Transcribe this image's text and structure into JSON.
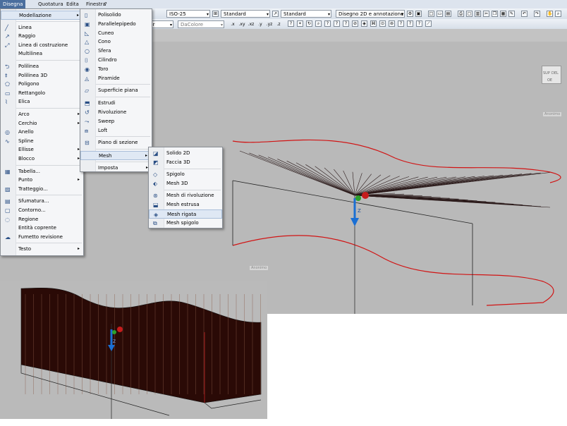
{
  "menubar": {
    "items": [
      {
        "label": "Disegna",
        "active": true
      },
      {
        "label": "Quotatura"
      },
      {
        "label": "Edita"
      },
      {
        "label": "Finestra"
      },
      {
        "label": "?"
      }
    ]
  },
  "toolbar": {
    "dimstyle": "ISO-25",
    "tablestyle": "Standard",
    "mleaderstyle": "Standard",
    "workspace": "Disegno 2D e annotazione",
    "layer_fragment": "yer",
    "color": "DaColore",
    "ucs_buttons": [
      ".x",
      ".xy",
      ".xz",
      ".y",
      ".yz",
      ".z"
    ]
  },
  "main_menu": {
    "items": [
      {
        "label": "Modellazione",
        "submenu": true,
        "highlight": true,
        "icon": "none-icon"
      },
      {
        "sep": true
      },
      {
        "label": "Linea",
        "icon": "line-icon"
      },
      {
        "label": "Raggio",
        "icon": "ray-icon"
      },
      {
        "label": "Linea di costruzione",
        "icon": "xline-icon"
      },
      {
        "label": "Multilinea",
        "icon": "none-icon"
      },
      {
        "sep": true
      },
      {
        "label": "Polilinea",
        "icon": "polyline-icon"
      },
      {
        "label": "Polilinea 3D",
        "icon": "3dpoly-icon"
      },
      {
        "label": "Poligono",
        "icon": "polygon-icon"
      },
      {
        "label": "Rettangolo",
        "icon": "rectangle-icon"
      },
      {
        "label": "Elica",
        "icon": "helix-icon"
      },
      {
        "sep": true
      },
      {
        "label": "Arco",
        "submenu": true,
        "icon": "none-icon"
      },
      {
        "label": "Cerchio",
        "submenu": true,
        "icon": "none-icon"
      },
      {
        "label": "Anello",
        "icon": "donut-icon"
      },
      {
        "label": "Spline",
        "icon": "spline-icon"
      },
      {
        "label": "Ellisse",
        "submenu": true,
        "icon": "none-icon"
      },
      {
        "label": "Blocco",
        "submenu": true,
        "icon": "none-icon"
      },
      {
        "sep": true
      },
      {
        "label": "Tabella...",
        "icon": "table-icon"
      },
      {
        "label": "Punto",
        "submenu": true,
        "icon": "none-icon"
      },
      {
        "label": "Tratteggio...",
        "icon": "hatch-icon"
      },
      {
        "sep": true
      },
      {
        "label": "Sfumatura...",
        "icon": "gradient-icon"
      },
      {
        "label": "Contorno...",
        "icon": "boundary-icon"
      },
      {
        "label": "Regione",
        "icon": "region-icon"
      },
      {
        "label": "Entità coprente",
        "icon": "none-icon"
      },
      {
        "label": "Fumetto revisione",
        "icon": "revcloud-icon"
      },
      {
        "sep": true
      },
      {
        "label": "Testo",
        "submenu": true,
        "icon": "none-icon"
      }
    ]
  },
  "modeling_menu": {
    "items": [
      {
        "label": "Polisolido",
        "icon": "polysolid-icon"
      },
      {
        "label": "Parallelepipedo",
        "icon": "box-icon"
      },
      {
        "label": "Cuneo",
        "icon": "wedge-icon"
      },
      {
        "label": "Cono",
        "icon": "cone-icon"
      },
      {
        "label": "Sfera",
        "icon": "sphere-icon"
      },
      {
        "label": "Cilindro",
        "icon": "cylinder-icon"
      },
      {
        "label": "Toro",
        "icon": "torus-icon"
      },
      {
        "label": "Piramide",
        "icon": "pyramid-icon"
      },
      {
        "sep": true
      },
      {
        "label": "Superficie piana",
        "icon": "planesurf-icon"
      },
      {
        "sep": true
      },
      {
        "label": "Estrudi",
        "icon": "extrude-icon"
      },
      {
        "label": "Rivoluzione",
        "icon": "revolve-icon"
      },
      {
        "label": "Sweep",
        "icon": "sweep-icon"
      },
      {
        "label": "Loft",
        "icon": "loft-icon"
      },
      {
        "sep": true
      },
      {
        "label": "Piano di sezione",
        "icon": "sectionplane-icon"
      },
      {
        "sep": true
      },
      {
        "label": "Mesh",
        "submenu": true,
        "highlight": true,
        "icon": "none-icon"
      },
      {
        "sep": true
      },
      {
        "label": "Imposta",
        "submenu": true,
        "icon": "none-icon"
      }
    ]
  },
  "mesh_menu": {
    "items": [
      {
        "label": "Solido 2D",
        "icon": "solid2d-icon"
      },
      {
        "label": "Faccia 3D",
        "icon": "3dface-icon"
      },
      {
        "sep": true
      },
      {
        "label": "Spigolo",
        "icon": "edge-icon"
      },
      {
        "label": "Mesh 3D",
        "icon": "3dmesh-icon"
      },
      {
        "sep": true
      },
      {
        "label": "Mesh di rivoluzione",
        "icon": "revsurf-icon"
      },
      {
        "label": "Mesh estrusa",
        "icon": "tabsurf-icon"
      },
      {
        "label": "Mesh rigata",
        "icon": "rulesurf-icon",
        "highlight": true
      },
      {
        "label": "Mesh spigolo",
        "icon": "edgesurf-icon"
      }
    ]
  },
  "viewport": {
    "viewcube_label": "Anonimo",
    "axis_label": "Z",
    "bottom_tag": "Anonimo",
    "cube_faces": [
      "SUP",
      "DEL",
      "OE"
    ]
  },
  "colors": {
    "accent": "#4a6e9e",
    "curve": "#d11414",
    "surface": "#2a0a06"
  }
}
